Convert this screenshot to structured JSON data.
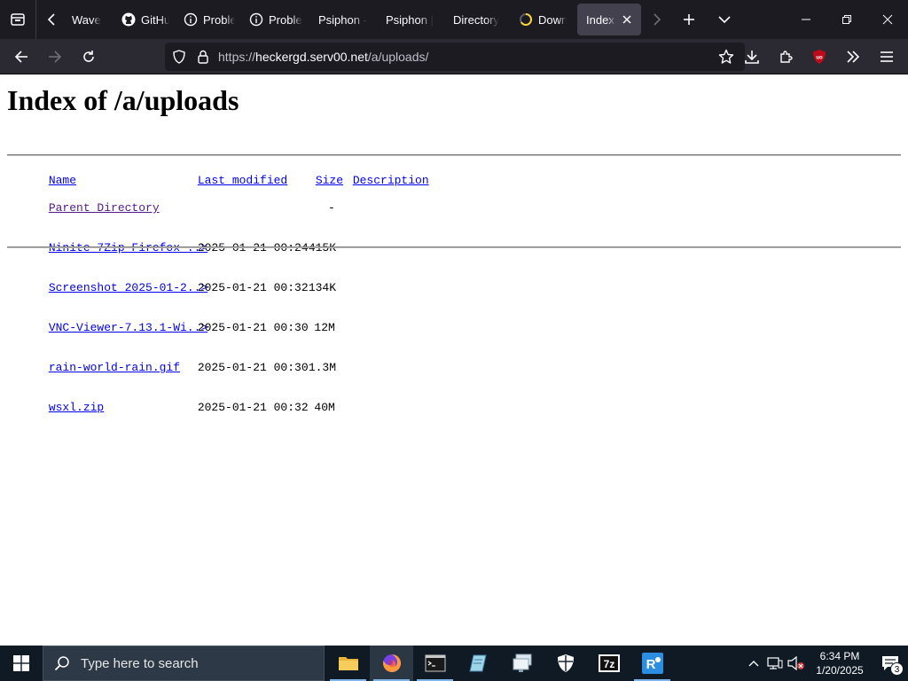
{
  "browser": {
    "tabs": [
      {
        "title": "Wave",
        "icon": "wave-icon"
      },
      {
        "title": "GitHub",
        "icon": "github-icon"
      },
      {
        "title": "Problem",
        "icon": "info-icon"
      },
      {
        "title": "Problem",
        "icon": "info-icon"
      },
      {
        "title": "Psiphon -",
        "icon": "none"
      },
      {
        "title": "Psiphon |",
        "icon": "none"
      },
      {
        "title": "Directory",
        "icon": "none"
      },
      {
        "title": "Down",
        "icon": "loading-spinner-icon"
      },
      {
        "title": "Index",
        "icon": "none",
        "active": true
      }
    ],
    "url_prefix": "https://",
    "url_host": "heckergd.serv00.net",
    "url_path": "/a/uploads/"
  },
  "page": {
    "title": "Index of /a/uploads",
    "headers": {
      "name": "Name",
      "last_modified": "Last modified",
      "size": "Size",
      "description": "Description"
    },
    "parent": {
      "name": "Parent Directory",
      "size": "-"
    },
    "files": [
      {
        "name": "Ninite 7Zip Firefox ..>",
        "modified": "2025-01-21 00:24",
        "size": "415K"
      },
      {
        "name": "Screenshot 2025-01-2..>",
        "modified": "2025-01-21 00:32",
        "size": "134K"
      },
      {
        "name": "VNC-Viewer-7.13.1-Wi..>",
        "modified": "2025-01-21 00:30",
        "size": "12M"
      },
      {
        "name": "rain-world-rain.gif",
        "modified": "2025-01-21 00:30",
        "size": "1.3M"
      },
      {
        "name": "wsxl.zip",
        "modified": "2025-01-21 00:32",
        "size": "40M"
      }
    ]
  },
  "taskbar": {
    "search_placeholder": "Type here to search",
    "time": "6:34 PM",
    "date": "1/20/2025",
    "notification_count": "3"
  }
}
